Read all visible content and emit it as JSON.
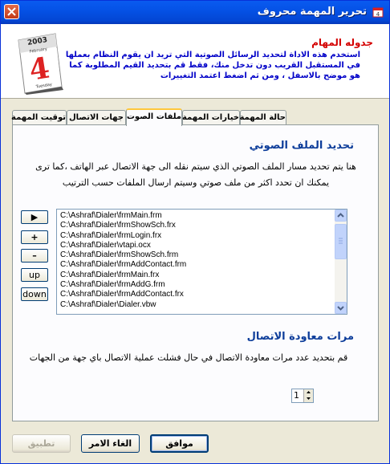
{
  "window": {
    "title": "تحرير المهمة محروف"
  },
  "header": {
    "title": "جدوله المهام",
    "description": "استخدم هذه الاداة لتحديد الرسائل الصوتية التي تريد ان يقوم النظام بعملها في المستقبل القريب دون تدخل منك، فقط قم بتحديد القيم المطلوبة كما هو موضح بالاسفل ، ومن ثم اضغط اعتمد التغييرات",
    "calendar": {
      "year": "2003",
      "month": "February",
      "day": "4",
      "weekday": "Tuesday"
    }
  },
  "tabs": [
    {
      "label": "توقيت المهمة"
    },
    {
      "label": "جهات الاتصال"
    },
    {
      "label": "ملفات الصوت"
    },
    {
      "label": "خيارات المهمة"
    },
    {
      "label": "حالة المهمة"
    }
  ],
  "sound_files": {
    "title": "تحديد الملف الصوتي",
    "description": "هنا يتم تحديد مسار الملف الصوتي الذي سيتم نقله الى جهة الاتصال عبر الهاتف ،كما ترى يمكنك ان تحدد اكثر من ملف صوتي وسيتم ارسال الملفات حسب الترتيب",
    "buttons": {
      "play": "▶",
      "add": "+",
      "remove": "–",
      "up": "up",
      "down": "down"
    },
    "files": [
      "C:\\Ashraf\\Dialer\\frmMain.frm",
      "C:\\Ashraf\\Dialer\\frmShowSch.frx",
      "C:\\Ashraf\\Dialer\\frmLogin.frx",
      "C:\\Ashraf\\Dialer\\vtapi.ocx",
      "C:\\Ashraf\\Dialer\\frmShowSch.frm",
      "C:\\Ashraf\\Dialer\\frmAddContact.frm",
      "C:\\Ashraf\\Dialer\\frmMain.frx",
      "C:\\Ashraf\\Dialer\\frmAddG.frm",
      "C:\\Ashraf\\Dialer\\frmAddContact.frx",
      "C:\\Ashraf\\Dialer\\Dialer.vbw"
    ]
  },
  "retry": {
    "title": "مرات معاودة الاتصال",
    "description": "قم بتحديد عدد مرات معاودة الاتصال في حال فشلت عملية الاتصال باي جهة من الجهات",
    "value": "1"
  },
  "footer": {
    "apply_label": "تطبيق",
    "cancel_label": "الغاء الامر",
    "ok_label": "موافق"
  },
  "colors": {
    "title_bar": "#0552e6",
    "header_title": "#d40000",
    "header_desc": "#0000c8",
    "section_title": "#0d3d9a"
  }
}
